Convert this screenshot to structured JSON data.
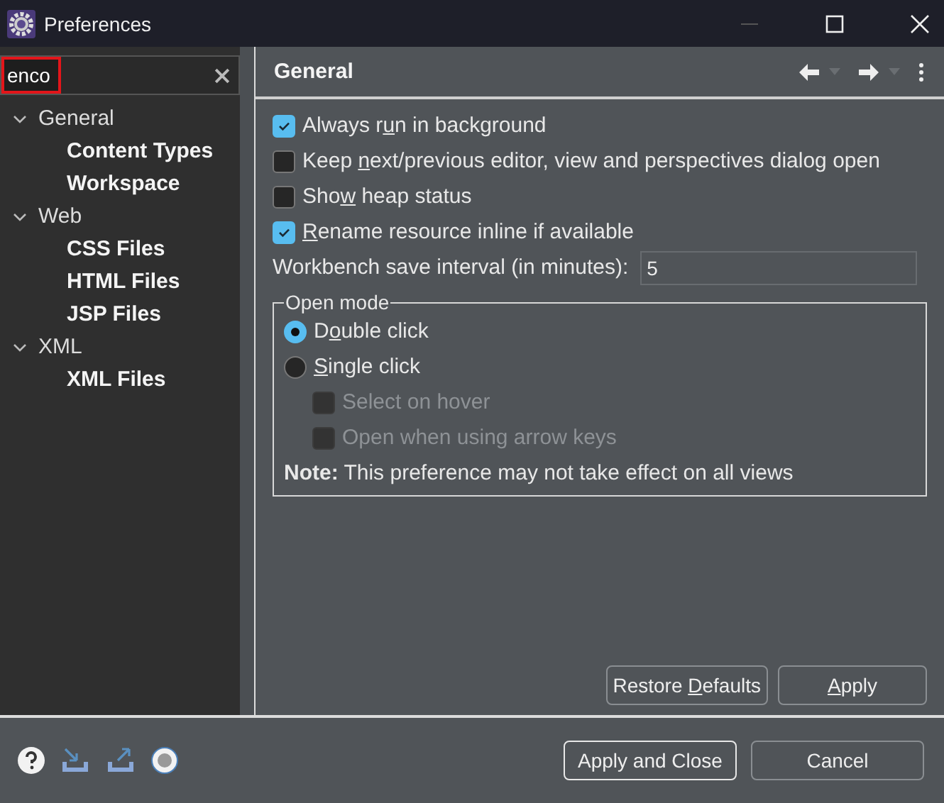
{
  "window": {
    "title": "Preferences"
  },
  "filter": {
    "value": "enco"
  },
  "tree": [
    {
      "label": "General",
      "expanded": true,
      "matched": false,
      "children": [
        {
          "label": "Content Types",
          "matched": true
        },
        {
          "label": "Workspace",
          "matched": true
        }
      ]
    },
    {
      "label": "Web",
      "expanded": true,
      "matched": false,
      "children": [
        {
          "label": "CSS Files",
          "matched": true
        },
        {
          "label": "HTML Files",
          "matched": true
        },
        {
          "label": "JSP Files",
          "matched": true
        }
      ]
    },
    {
      "label": "XML",
      "expanded": true,
      "matched": false,
      "children": [
        {
          "label": "XML Files",
          "matched": true
        }
      ]
    }
  ],
  "page": {
    "title": "General",
    "options": [
      {
        "label": {
          "before": "Always r",
          "key": "u",
          "after": "n in background"
        },
        "checked": true,
        "disabled": false
      },
      {
        "label": {
          "before": "Keep ",
          "key": "n",
          "after": "ext/previous editor, view and perspectives dialog open"
        },
        "checked": false,
        "disabled": false
      },
      {
        "label": {
          "before": "Sho",
          "key": "w",
          "after": " heap status"
        },
        "checked": false,
        "disabled": false
      },
      {
        "label": {
          "key": "R",
          "after": "ename resource inline if available"
        },
        "checked": true,
        "disabled": false
      }
    ],
    "interval": {
      "label": "Workbench save interval (in minutes):",
      "value": "5"
    },
    "open_mode": {
      "title": "Open mode",
      "radios": [
        {
          "label": {
            "before": "D",
            "key": "o",
            "after": "uble click"
          },
          "selected": true
        },
        {
          "label": {
            "key": "S",
            "after": "ingle click"
          },
          "selected": false
        }
      ],
      "suboptions": [
        {
          "label": "Select on hover",
          "checked": false,
          "disabled": true
        },
        {
          "label": "Open when using arrow keys",
          "checked": false,
          "disabled": true
        }
      ],
      "note": "**Note:** This preference may not take effect on all views"
    },
    "buttons": [
      {
        "label": {
          "before": "Restore ",
          "key": "D",
          "after": "efaults"
        }
      },
      {
        "label": {
          "key": "A",
          "after": "pply"
        }
      }
    ]
  },
  "footer_buttons": [
    {
      "label": "Apply and Close",
      "default": true
    },
    {
      "label": "Cancel",
      "default": false
    }
  ]
}
